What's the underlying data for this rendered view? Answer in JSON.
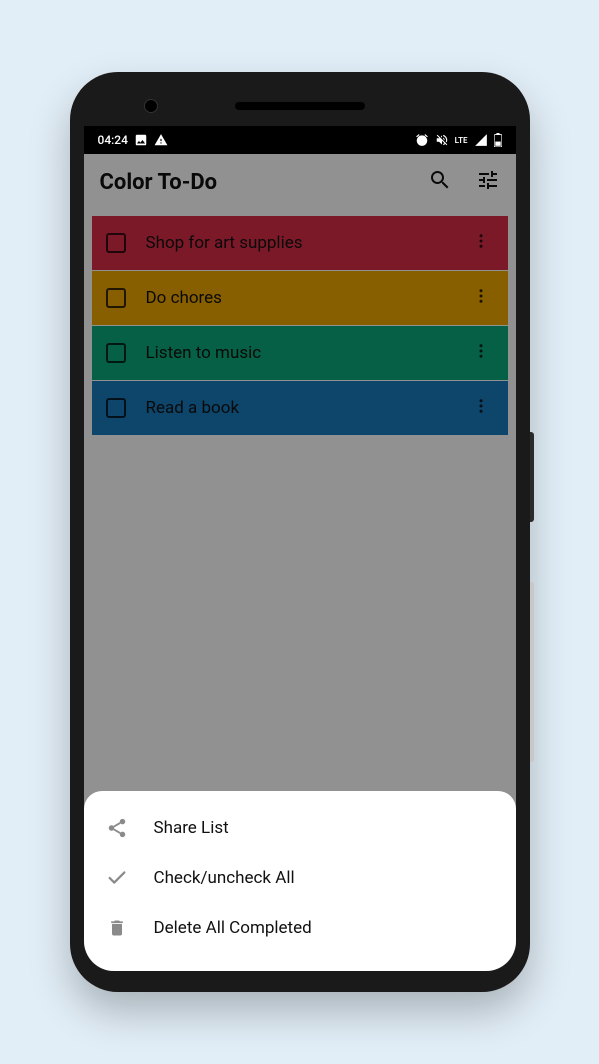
{
  "status": {
    "time": "04:24"
  },
  "app": {
    "title": "Color To-Do"
  },
  "tasks": [
    {
      "label": "Shop for art supplies",
      "color": "red"
    },
    {
      "label": "Do chores",
      "color": "yellow"
    },
    {
      "label": "Listen to music",
      "color": "green"
    },
    {
      "label": "Read a book",
      "color": "blue"
    }
  ],
  "sheet": {
    "share": "Share List",
    "checkall": "Check/uncheck All",
    "deletecompleted": "Delete All Completed"
  }
}
